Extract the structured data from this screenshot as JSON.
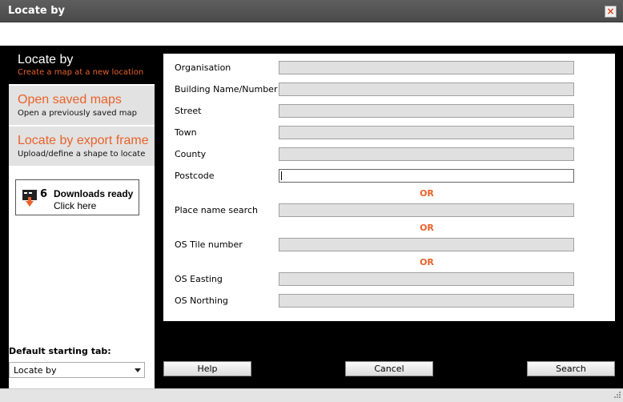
{
  "window": {
    "title": "Locate by",
    "close_label": "×"
  },
  "sidebar": {
    "active_tab": {
      "title": "Locate by",
      "subtitle": "Create a map at a new location"
    },
    "tabs": [
      {
        "title": "Open saved maps",
        "subtitle": "Open a previously saved map"
      },
      {
        "title": "Locate by export frame",
        "subtitle": "Upload/define a shape to locate"
      }
    ],
    "downloads": {
      "count": "6",
      "title": "Downloads ready",
      "link": "Click here"
    },
    "default_tab": {
      "label": "Default starting tab:",
      "value": "Locate by"
    }
  },
  "form": {
    "fields": [
      {
        "label": "Organisation",
        "value": ""
      },
      {
        "label": "Building Name/Number",
        "value": ""
      },
      {
        "label": "Street",
        "value": ""
      },
      {
        "label": "Town",
        "value": ""
      },
      {
        "label": "County",
        "value": ""
      },
      {
        "label": "Postcode",
        "value": ""
      },
      {
        "label": "Place name search",
        "value": ""
      },
      {
        "label": "OS Tile number",
        "value": ""
      },
      {
        "label": "OS Easting",
        "value": ""
      },
      {
        "label": "OS Northing",
        "value": ""
      }
    ],
    "or_label": "OR"
  },
  "buttons": {
    "help": "Help",
    "cancel": "Cancel",
    "search": "Search"
  },
  "colors": {
    "accent": "#e8622a",
    "panel_bg": "#000000",
    "tab_bg": "#e2e2e2"
  }
}
